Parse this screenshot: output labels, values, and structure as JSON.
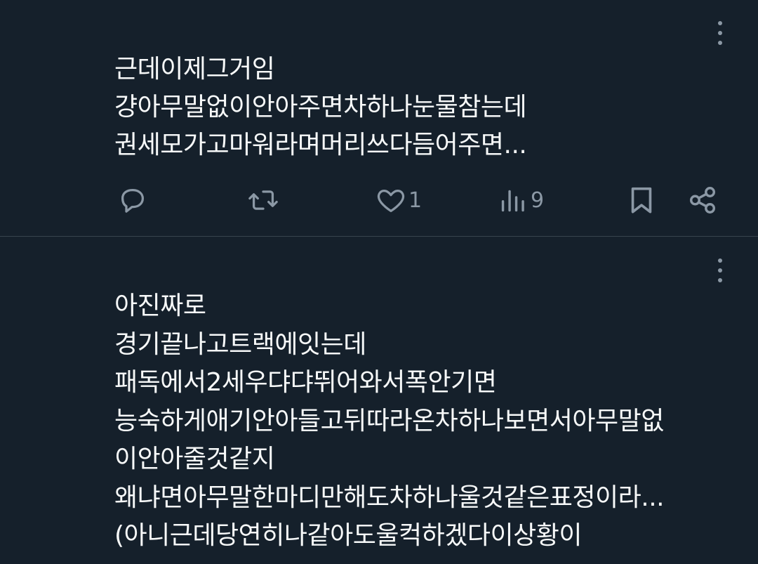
{
  "tweets": [
    {
      "lines": [
        "근데이제그거임",
        "걍아무말없이안아주면차하나눈물참는데",
        "권세모가고마워라며머리쓰다듬어주면..."
      ],
      "actions": {
        "reply_icon": "reply-icon",
        "retweet_icon": "retweet-icon",
        "like_icon": "heart-icon",
        "like_count": "1",
        "views_icon": "views-icon",
        "view_count": "9",
        "bookmark_icon": "bookmark-icon",
        "share_icon": "share-icon"
      }
    },
    {
      "lines": [
        "아진짜로",
        "경기끝나고트랙에잇는데",
        "패독에서2세우댜댜뛰어와서폭안기면",
        "능숙하게애기안아들고뒤따라온차하나보면서아무말없",
        "이안아줄것같지",
        "왜냐면아무말한마디만해도차하나울것같은표정이라...",
        "(아니근데당연히나같아도울컥하겠다이상황이"
      ]
    }
  ],
  "colors": {
    "background": "#15202b",
    "text": "#f7f9f9",
    "muted": "#8b98a5",
    "divider": "#38444d"
  }
}
